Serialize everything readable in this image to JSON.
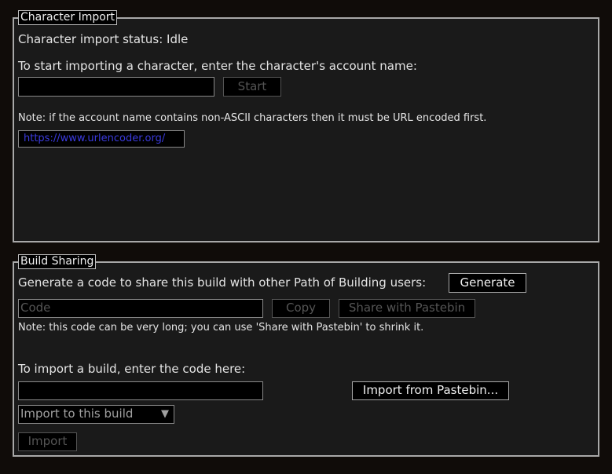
{
  "character_import": {
    "title": "Character Import",
    "status": "Character import status: Idle",
    "instruction": "To start importing a character, enter the character's account name:",
    "account_value": "",
    "start_label": "Start",
    "note": "Note: if the account name contains non-ASCII characters then it must be URL encoded first.",
    "link": "https://www.urlencoder.org/",
    "link_color": "#3a3adc"
  },
  "build_sharing": {
    "title": "Build Sharing",
    "generate_text": "Generate a code to share this build with other Path of Building users:",
    "generate_label": "Generate",
    "code_placeholder": "Code",
    "copy_label": "Copy",
    "share_label": "Share with Pastebin",
    "note": "Note: this code can be very long; you can use 'Share with Pastebin' to shrink it.",
    "import_text": "To import a build, enter the code here:",
    "import_code_value": "",
    "import_pastebin_label": "Import from Pastebin...",
    "import_target": "Import to this build",
    "import_label": "Import"
  }
}
